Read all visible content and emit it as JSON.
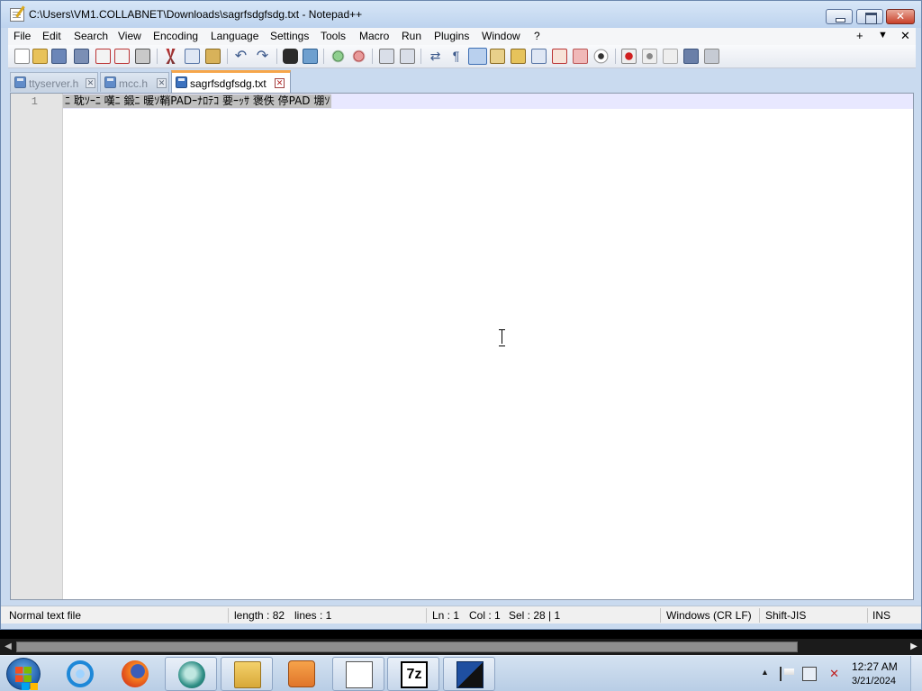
{
  "window": {
    "title": "C:\\Users\\VM1.COLLABNET\\Downloads\\sagrfsdgfsdg.txt - Notepad++"
  },
  "menu": {
    "items": [
      "File",
      "Edit",
      "Search",
      "View",
      "Encoding",
      "Language",
      "Settings",
      "Tools",
      "Macro",
      "Run",
      "Plugins",
      "Window",
      "?"
    ],
    "right": [
      "+",
      "▼",
      "✕"
    ]
  },
  "tabs": [
    {
      "label": "ttyserver.h",
      "active": false
    },
    {
      "label": "mcc.h",
      "active": false
    },
    {
      "label": "sagrfsdgfsdg.txt",
      "active": true
    }
  ],
  "editor": {
    "line_numbers": [
      "1"
    ],
    "line_text": "ﾆ 耽ｿｰﾆ 嘆ﾆ 鍛ﾆ 暖ｿ鞘PADｰﾅﾛﾃｺ 要ｰｯｻ 褒佚 停PAD 堋ｿ"
  },
  "status": {
    "file_type": "Normal text file",
    "length": "length : 82",
    "lines": "lines : 1",
    "ln": "Ln : 1",
    "col": "Col : 1",
    "sel": "Sel : 28 | 1",
    "eol": "Windows (CR LF)",
    "encoding": "Shift-JIS",
    "mode": "INS"
  },
  "taskbar": {
    "apps": [
      "internet-explorer",
      "firefox",
      "app-circle",
      "file-explorer",
      "media-player",
      "notepad-plus-plus",
      "7zip",
      "network-app"
    ],
    "clock_time": "12:27 AM",
    "clock_date": "3/21/2024"
  }
}
